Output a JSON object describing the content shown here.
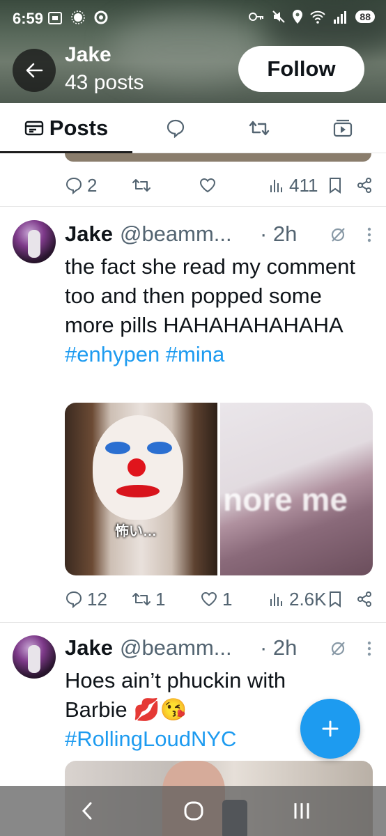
{
  "status_bar": {
    "time": "6:59",
    "battery": "88"
  },
  "header": {
    "name": "Jake",
    "post_count": "43 posts",
    "follow_label": "Follow"
  },
  "tabs": [
    {
      "label": "Posts",
      "icon": "posts-icon",
      "active": true
    },
    {
      "label": "",
      "icon": "replies-icon"
    },
    {
      "label": "",
      "icon": "reposts-icon"
    },
    {
      "label": "",
      "icon": "media-icon"
    }
  ],
  "prev_post_actions": {
    "replies": "2",
    "reposts": "",
    "likes": "",
    "views": "411"
  },
  "posts": [
    {
      "name": "Jake",
      "handle": "@beamm...",
      "time": "· 2h",
      "text": "the fact she read my comment too and then popped some more pills HAHAHAHAHAHA",
      "hashtags": "#enhypen #mina",
      "media_caption": "怖い…",
      "media_overlay": "nore me",
      "replies": "12",
      "reposts": "1",
      "likes": "1",
      "views": "2.6K"
    },
    {
      "name": "Jake",
      "handle": "@beamm...",
      "time": "· 2h",
      "text": "Hoes ain’t phuckin with Barbie 💋😘",
      "hashtags": "#RollingLoudNYC"
    }
  ],
  "colors": {
    "accent": "#1d9bf0",
    "text": "#0f1419",
    "muted": "#536471"
  }
}
